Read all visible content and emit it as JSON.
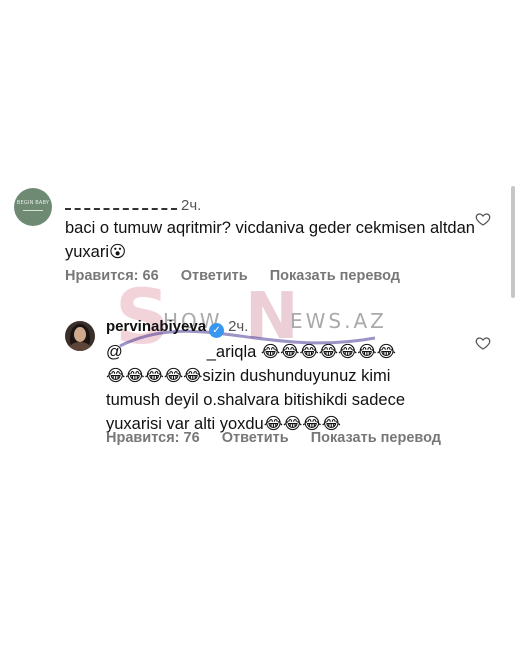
{
  "comments": [
    {
      "username": "",
      "time": "2ч.",
      "text": "baci o tumuw aqritmir? vicdaniva geder cekmisen altdan yuxari😮",
      "likes_label": "Нравится: 66",
      "reply_label": "Ответить",
      "translate_label": "Показать перевод"
    },
    {
      "username": "pervinabiyeva",
      "verified": true,
      "time": "2ч.",
      "mention_prefix": "@",
      "mention_suffix": "_ariqla",
      "text_line1_emojis": "😂😂😂😂😂😂😂",
      "text_line2": "😂😂😂😂😂sizin dushunduyunuz kimi",
      "text_line3": "tumush deyil o.shalvara bitishikdi sadece",
      "text_line4": "yuxarisi var alti yoxdu😂😂😂😂",
      "likes_label": "Нравится: 76",
      "reply_label": "Ответить",
      "translate_label": "Показать перевод"
    }
  ],
  "watermark": {
    "left": "S",
    "show": "HOW",
    "n": "N",
    "ews": "EWS.AZ"
  },
  "icons": {
    "like": "heart-outline-icon",
    "verified": "verified-badge-icon"
  },
  "colors": {
    "verified": "#3897f0",
    "watermark_pink": "#e8aab8",
    "watermark_purple": "#3a2a8c"
  }
}
